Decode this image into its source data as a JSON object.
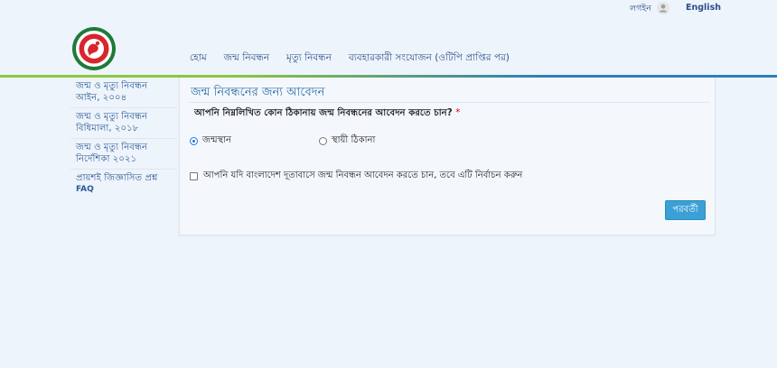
{
  "topbar": {
    "login": "লগইন",
    "language": "English"
  },
  "nav": {
    "items": [
      {
        "label": "হোম"
      },
      {
        "label": "জন্ম নিবন্ধন"
      },
      {
        "label": "মৃত্যু নিবন্ধন"
      },
      {
        "label": "ব্যবহারকারী সংযোজন (ওটিপি প্রাপ্তির পর)"
      }
    ]
  },
  "sidebar": {
    "items": [
      {
        "line1": "জন্ম ও মৃত্যু নিবন্ধন",
        "line2": "আইন, ২০০৪"
      },
      {
        "line1": "জন্ম ও মৃত্যু নিবন্ধন",
        "line2": "বিধিমালা, ২০১৮"
      },
      {
        "line1": "জন্ম ও মৃত্যু নিবন্ধন",
        "line2": "নির্দেশিকা ২০২১"
      },
      {
        "line1": "প্রায়শই জিজ্ঞাসিত প্রশ্ন",
        "line2": "FAQ"
      }
    ]
  },
  "form": {
    "title": "জন্ম নিবন্ধনের জন্য আবেদন",
    "question": "আপনি নিম্নলিখিত কোন ঠিকানায় জন্ম নিবন্ধনের আবেদন করতে চান?",
    "required_mark": "*",
    "options": [
      {
        "label": "জন্মস্থান",
        "checked": true
      },
      {
        "label": "স্থায়ী ঠিকানা",
        "checked": false
      }
    ],
    "embassy_checkbox": "আপনি যদি বাংলাদেশ দূতাবাসে জন্ম নিবন্ধন আবেদন করতে চান, তবে এটি নির্বাচন করুন",
    "embassy_checked": false,
    "next_label": "পরবর্তী"
  },
  "colors": {
    "accent": "#3aa0d5",
    "link": "#2a4f8a",
    "title": "#2a6aa8",
    "header_green": "#8cc63f",
    "header_blue": "#2e7fb8"
  },
  "icons": {
    "user": "user-icon",
    "logo": "government-seal-logo"
  }
}
